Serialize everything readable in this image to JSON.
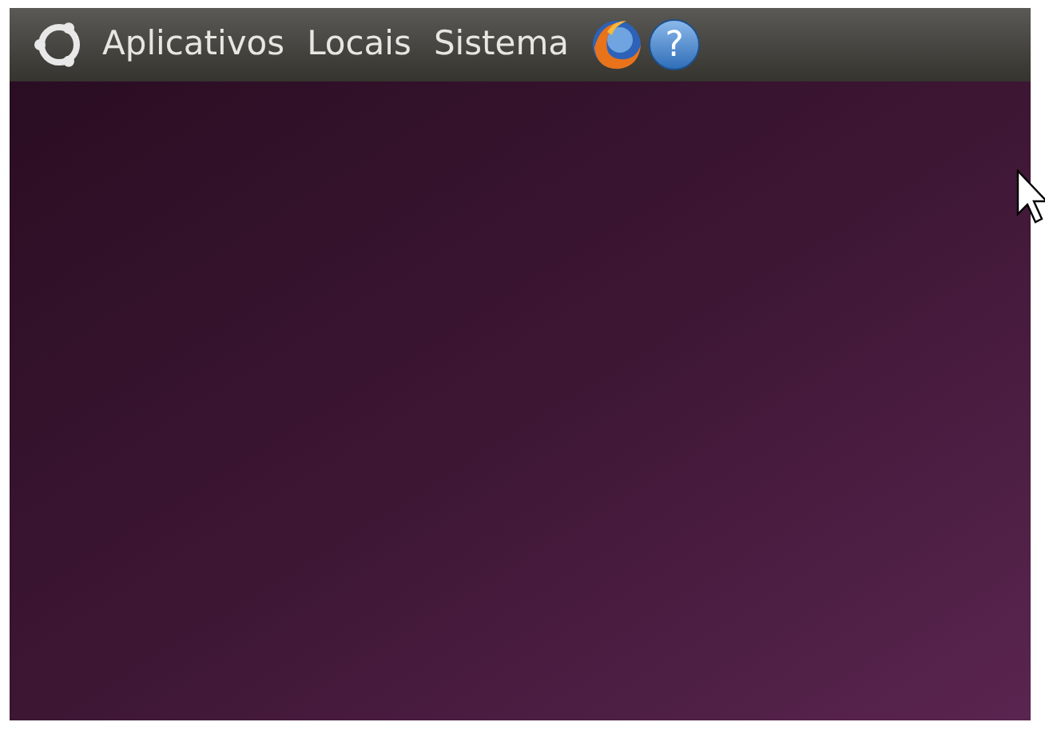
{
  "panel": {
    "menus": [
      {
        "label": "Aplicativos"
      },
      {
        "label": "Locais"
      },
      {
        "label": "Sistema"
      }
    ],
    "help_glyph": "?"
  }
}
